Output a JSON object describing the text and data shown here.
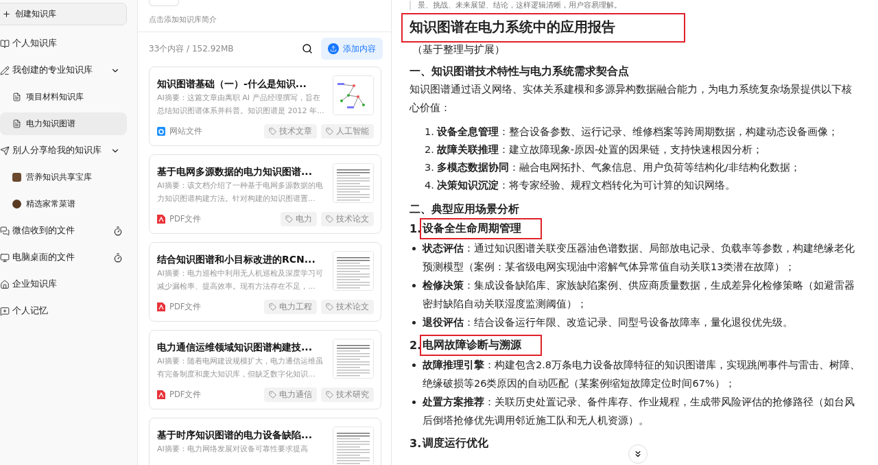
{
  "sidebar": {
    "items": [
      {
        "kind": "create",
        "label": "创建知识库"
      },
      {
        "kind": "item",
        "label": "个人知识库",
        "selected": false
      },
      {
        "kind": "group",
        "label": "我创建的专业知识库",
        "expanded": true,
        "children": [
          {
            "label": "项目材料知识库",
            "selected": false
          },
          {
            "label": "电力知识图谱",
            "selected": true
          }
        ]
      },
      {
        "kind": "group",
        "label": "别人分享给我的知识库",
        "expanded": true,
        "children": [
          {
            "label": "营养知识共享宝库",
            "selected": false
          },
          {
            "label": "精选家常菜谱",
            "selected": false
          }
        ]
      },
      {
        "kind": "clock",
        "label": "微信收到的文件",
        "selected": false
      },
      {
        "kind": "clock",
        "label": "电脑桌面的文件",
        "selected": false
      },
      {
        "kind": "item",
        "label": "企业知识库",
        "selected": false
      },
      {
        "kind": "item",
        "label": "个人记忆",
        "selected": false
      }
    ]
  },
  "library": {
    "intro_placeholder": "点击添加知识库简介",
    "stats": "33个内容 / 152.92MB",
    "add_button": "添加内容",
    "cards": [
      {
        "kind": "web",
        "title": "知识图谱基础（一）-什么是知识...",
        "summary": "AI摘要：这篇文章由离职 AI 产品经理撰写，旨在总结知识图谱体系并科普。知识图谱是 2012 年...",
        "file_label": "网站文件",
        "tags": [
          "技术文章",
          "人工智能"
        ]
      },
      {
        "kind": "pdf",
        "title": "基于电网多源数据的电力知识图谱...",
        "summary": "AI摘要：该文档介绍了一种基于电网多源数据的电力知识图谱构建方法。针对构建的知识图谱置...",
        "file_label": "PDF文件",
        "tags": [
          "电力",
          "技术论文"
        ]
      },
      {
        "kind": "pdf",
        "title": "结合知识图谱和小目标改进的RCN...",
        "summary": "AI摘要：电力巡检中利用无人机巡检及深度学习可减少漏检率、提高效率。现有方法存在不足，...",
        "file_label": "PDF文件",
        "tags": [
          "电力工程",
          "技术论文"
        ]
      },
      {
        "kind": "pdf",
        "title": "电力通信运维领域知识图谱构建技...",
        "summary": "AI摘要：随着电网建设规模扩大，电力通信运维虽有完备制度和庞大知识库，但缺乏数字化知识...",
        "file_label": "PDF文件",
        "tags": [
          "电力通信",
          "技术研究"
        ]
      },
      {
        "kind": "pdf",
        "title": "基于时序知识图谱的电力设备缺陷...",
        "summary": "AI摘要：电力网络发展对设备可靠性要求提高"
      }
    ]
  },
  "document": {
    "blocks": [
      {
        "kind": "quote",
        "text": "景、挑战、未来展望、结论，这样逻辑清晰，用户容易理解。"
      },
      {
        "kind": "title",
        "text": "知识图谱在电力系统中的应用报告",
        "boxed": true
      },
      {
        "kind": "subtitle",
        "text": "（基于整理与扩展）"
      },
      {
        "kind": "h2",
        "text": "一、知识图谱技术特性与电力系统需求契合点"
      },
      {
        "kind": "para",
        "text": "知识图谱通过语义网络、实体关系建模和多源异构数据融合能力，为电力系统复杂场景提供以下核心价值："
      },
      {
        "kind": "ol",
        "items": [
          {
            "number": "1.",
            "text": "**设备全息管理**：整合设备参数、运行记录、维修档案等跨周期数据，构建动态设备画像；"
          },
          {
            "number": "2.",
            "text": "**故障关联推理**：建立故障现象-原因-处置的因果链，支持快速根因分析；"
          },
          {
            "number": "3.",
            "text": "**多模态数据协同**：融合电网拓扑、气象信息、用户负荷等结构化/非结构化数据；"
          },
          {
            "number": "4.",
            "text": "**决策知识沉淀**：将专家经验、规程文档转化为可计算的知识网络。"
          }
        ]
      },
      {
        "kind": "h2",
        "text": "二、典型应用场景分析"
      },
      {
        "kind": "h3",
        "number": "1.",
        "text": "设备全生命周期管理",
        "boxed": true
      },
      {
        "kind": "ul",
        "items": [
          {
            "text": "**状态评估**：通过知识图谱关联变压器油色谱数据、局部放电记录、负载率等参数，构建绝缘老化预测模型（案例：某省级电网实现油中溶解气体异常值自动关联13类潜在故障）；"
          },
          {
            "text": "**检修决策**：集成设备缺陷库、家族缺陷案例、供应商质量数据，生成差异化检修策略（如避雷器密封缺陷自动关联湿度监测阈值）；"
          },
          {
            "text": "**退役评估**：结合设备运行年限、改造记录、同型号设备故障率，量化退役优先级。"
          }
        ]
      },
      {
        "kind": "h3",
        "number": "2.",
        "text": "电网故障诊断与溯源",
        "boxed": true
      },
      {
        "kind": "ul",
        "items": [
          {
            "text": "**故障推理引擎**：构建包含2.8万条电力设备故障特征的知识图谱库，实现跳闸事件与雷击、树障、绝缘破损等26类原因的自动匹配（某案例缩短故障定位时间67%）；"
          },
          {
            "text": "**处置方案推荐**：关联历史处置记录、备件库存、作业规程，生成带风险评估的抢修路径（如台风后倒塔抢修优先调用邻近施工队和无人机资源）。"
          }
        ]
      },
      {
        "kind": "h3",
        "number": "3.",
        "text": "调度运行优化",
        "boxed": false
      }
    ]
  }
}
